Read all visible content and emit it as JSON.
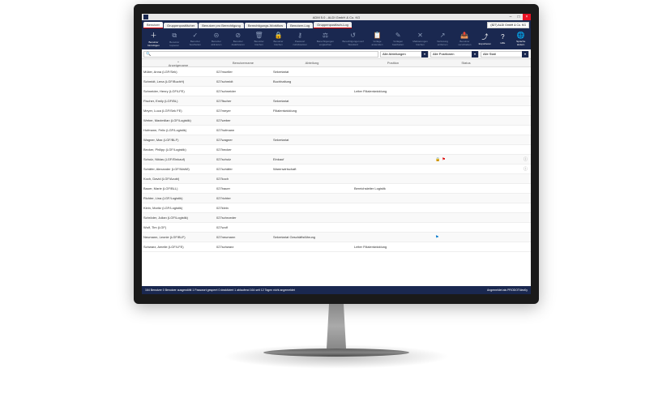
{
  "window": {
    "title": "ADM 5.0 - ALDI GmbH & Co. KG",
    "org": "(827)   ALDI GmbH & Co. KG"
  },
  "tabs": {
    "items": [
      {
        "label": "Benutzer",
        "active": true
      },
      {
        "label": "Gruppenpostfächer"
      },
      {
        "label": "Benutzer pro Berechtigung"
      },
      {
        "label": "Berechtigungs-Workflow"
      },
      {
        "label": "Benutzer-Log"
      },
      {
        "label": "Gruppenpostfach-Log",
        "red": true
      }
    ]
  },
  "toolbar": {
    "items": [
      {
        "icon": "＋",
        "label": "Benutzer hinzufügen",
        "active": true
      },
      {
        "icon": "⧉",
        "label": "Benutzer kopieren"
      },
      {
        "icon": "✓",
        "label": "Benutzer bearbeiten"
      },
      {
        "icon": "⊝",
        "label": "Benutzer aktivieren"
      },
      {
        "icon": "⊘",
        "label": "Benutzer deaktivieren"
      },
      {
        "icon": "🗑",
        "label": "Benutzer löschen"
      },
      {
        "icon": "🔒",
        "label": "Benutzer löschen"
      },
      {
        "icon": "⚷",
        "label": "Passwort zurücksetzen"
      },
      {
        "icon": "⚖",
        "label": "Berechtigungen vergleichen"
      },
      {
        "icon": "↺",
        "label": "Berechtigungen auf Standard"
      },
      {
        "icon": "📋",
        "label": "Vorlage anwenden"
      },
      {
        "icon": "✎",
        "label": "Vorlagen bearbeiten"
      },
      {
        "icon": "✕",
        "label": "Markierungen löschen"
      },
      {
        "icon": "↗",
        "label": "Vertretung entfernen"
      },
      {
        "icon": "📤",
        "label": "Benutzer verschieben"
      },
      {
        "icon": "⤴",
        "label": "Exportieren",
        "active": true
      },
      {
        "icon": "?",
        "label": "Hilfe",
        "active": true
      },
      {
        "icon": "🌐",
        "label": "Sprache ändern",
        "active": true
      }
    ]
  },
  "filters": {
    "search": "",
    "f1": "Alle Abteilungen",
    "f2": "Alle Positionen",
    "f3": "Alle Stati"
  },
  "columns": {
    "c1": "Anzeigename",
    "c2": "Benutzername",
    "c3": "Abteilung",
    "c4": "Position",
    "c5": "Status"
  },
  "rows": [
    {
      "name": "Müller, Anna (LGF/Sek)",
      "user": "027mueller",
      "dept": "Sekretariat",
      "pos": "",
      "status": ""
    },
    {
      "name": "Schmidt, Lena (LGF/BuchH)",
      "user": "027schmidt",
      "dept": "Buchhaltung",
      "pos": "",
      "status": ""
    },
    {
      "name": "Schneider, Henry (LGF/LFE)",
      "user": "027schneider",
      "dept": "",
      "pos": "Leiter Filialentwicklung",
      "status": ""
    },
    {
      "name": "Fischer, Emily (LGF/BL)",
      "user": "027fischer",
      "dept": "Sekretariat",
      "pos": "",
      "status": ""
    },
    {
      "name": "Meyer, Luca (LGF/Sek FE)",
      "user": "027meyer",
      "dept": "Filialentwicklung",
      "pos": "",
      "status": ""
    },
    {
      "name": "Weber, Maximilian (LGF/Logistik)",
      "user": "027weber",
      "dept": "",
      "pos": "",
      "status": ""
    },
    {
      "name": "Hofmann, Felix (LGF/Logistik)",
      "user": "027hofmann",
      "dept": "",
      "pos": "",
      "status": ""
    },
    {
      "name": "Wagner, Max (LGF/BLF)",
      "user": "027wagner",
      "dept": "Sekretariat",
      "pos": "",
      "status": ""
    },
    {
      "name": "Becker, Philipp (LGF/Logistik)",
      "user": "027becker",
      "dept": "",
      "pos": "",
      "status": ""
    },
    {
      "name": "Schulz, Niklas (LGF/Einkauf)",
      "user": "027schulz",
      "dept": "Einkauf",
      "pos": "",
      "status": "lock",
      "info": true
    },
    {
      "name": "Schäfer, Alexander (LGF/WaWi)",
      "user": "027schäfer",
      "dept": "Warenwirtschaft",
      "pos": "",
      "status": "",
      "info": true
    },
    {
      "name": "Koch, David (LGF/Azubi)",
      "user": "027koch",
      "dept": "",
      "pos": "",
      "status": ""
    },
    {
      "name": "Bauer, Marie (LGF/BLL)",
      "user": "027bauer",
      "dept": "",
      "pos": "Bereichsleiter Logistik",
      "status": ""
    },
    {
      "name": "Richter, Lina (LGF/Logistik)",
      "user": "027richter",
      "dept": "",
      "pos": "",
      "status": ""
    },
    {
      "name": "Klein, Moritz (LGF/Logistik)",
      "user": "027klein",
      "dept": "",
      "pos": "",
      "status": ""
    },
    {
      "name": "Schröder, Julian (LGF/Logistik)",
      "user": "027schroeder",
      "dept": "",
      "pos": "",
      "status": ""
    },
    {
      "name": "Wolf, Tim (LGF)",
      "user": "027wolf",
      "dept": "",
      "pos": "",
      "status": ""
    },
    {
      "name": "Neumann, Leonie (LGF/BLF)",
      "user": "027neumann",
      "dept": "Sekretariat Geschäftsführung",
      "pos": "",
      "status": "flag"
    },
    {
      "name": "Schwarz, Amelie (LGF/LFE)",
      "user": "027schwarz",
      "dept": "",
      "pos": "Leiter Filialentwicklung",
      "status": ""
    }
  ],
  "status": {
    "left": "164 Benutzer    0 Benutzer ausgewählt    1 Passwort gesperrt    0 deaktiviert    1 ablaufend    164 seit 12 Tagen nicht angemeldet",
    "right": "Angemeldet als PRODOT/ärsKy"
  }
}
